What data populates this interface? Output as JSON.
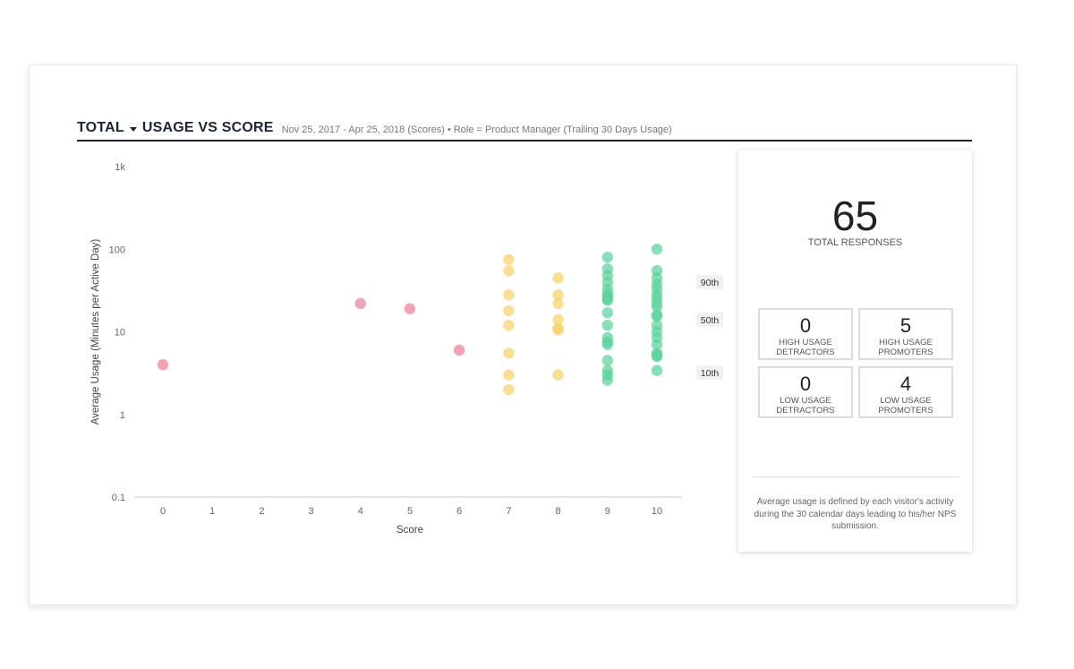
{
  "header": {
    "title_part1": "TOTAL",
    "title_part2": "USAGE VS SCORE",
    "subtitle": "Nov 25, 2017 - Apr 25, 2018 (Scores) • Role = Product Manager (Trailing 30 Days Usage)"
  },
  "colors": {
    "detractor": "#ee7f9a",
    "passive": "#f6d36b",
    "promoter": "#5bd39b",
    "axis": "#cccccc",
    "text": "#666666"
  },
  "chart_data": {
    "type": "scatter",
    "xlabel": "Score",
    "ylabel": "Average Usage (Minutes per Active Day)",
    "x_ticks": [
      "0",
      "1",
      "2",
      "3",
      "4",
      "5",
      "6",
      "7",
      "8",
      "9",
      "10"
    ],
    "y_ticks": [
      "0.1",
      "1",
      "10",
      "100",
      "1k"
    ],
    "y_scale": "log",
    "ylim": [
      0.1,
      1000
    ],
    "xlim": [
      0,
      10
    ],
    "percentiles": [
      {
        "label": "90th",
        "value": 40
      },
      {
        "label": "50th",
        "value": 14
      },
      {
        "label": "10th",
        "value": 3.2
      }
    ],
    "series": [
      {
        "category": "detractor",
        "points": [
          [
            0,
            4
          ],
          [
            4,
            22
          ],
          [
            5,
            19
          ],
          [
            6,
            6
          ]
        ]
      },
      {
        "category": "passive",
        "points": [
          [
            7,
            75
          ],
          [
            7,
            55
          ],
          [
            7,
            28
          ],
          [
            7,
            18
          ],
          [
            7,
            12
          ],
          [
            7,
            5.5
          ],
          [
            7,
            3
          ],
          [
            7,
            2
          ],
          [
            8,
            45
          ],
          [
            8,
            28
          ],
          [
            8,
            22
          ],
          [
            8,
            14
          ],
          [
            8,
            11
          ],
          [
            8,
            10.5
          ],
          [
            8,
            3
          ]
        ]
      },
      {
        "category": "promoter",
        "points": [
          [
            9,
            80
          ],
          [
            9,
            58
          ],
          [
            9,
            48
          ],
          [
            9,
            40
          ],
          [
            9,
            33
          ],
          [
            9,
            29
          ],
          [
            9,
            27
          ],
          [
            9,
            25
          ],
          [
            9,
            24
          ],
          [
            9,
            17
          ],
          [
            9,
            12
          ],
          [
            9,
            8.5
          ],
          [
            9,
            7.5
          ],
          [
            9,
            7
          ],
          [
            9,
            4.5
          ],
          [
            9,
            3.4
          ],
          [
            9,
            3
          ],
          [
            9,
            2.6
          ],
          [
            10,
            100
          ],
          [
            10,
            55
          ],
          [
            10,
            45
          ],
          [
            10,
            38
          ],
          [
            10,
            33
          ],
          [
            10,
            28
          ],
          [
            10,
            25
          ],
          [
            10,
            22
          ],
          [
            10,
            20
          ],
          [
            10,
            16
          ],
          [
            10,
            15.5
          ],
          [
            10,
            12
          ],
          [
            10,
            10
          ],
          [
            10,
            8.5
          ],
          [
            10,
            7
          ],
          [
            10,
            5.5
          ],
          [
            10,
            5.2
          ],
          [
            10,
            5
          ],
          [
            10,
            3.4
          ]
        ]
      }
    ]
  },
  "summary": {
    "total": "65",
    "total_label": "TOTAL RESPONSES",
    "quadrants": [
      {
        "value": "0",
        "line1": "HIGH USAGE",
        "line2": "DETRACTORS"
      },
      {
        "value": "5",
        "line1": "HIGH USAGE",
        "line2": "PROMOTERS"
      },
      {
        "value": "0",
        "line1": "LOW USAGE",
        "line2": "DETRACTORS"
      },
      {
        "value": "4",
        "line1": "LOW USAGE",
        "line2": "PROMOTERS"
      }
    ],
    "note": "Average usage is defined by each visitor's activity during the 30 calendar days leading to his/her NPS submission."
  }
}
